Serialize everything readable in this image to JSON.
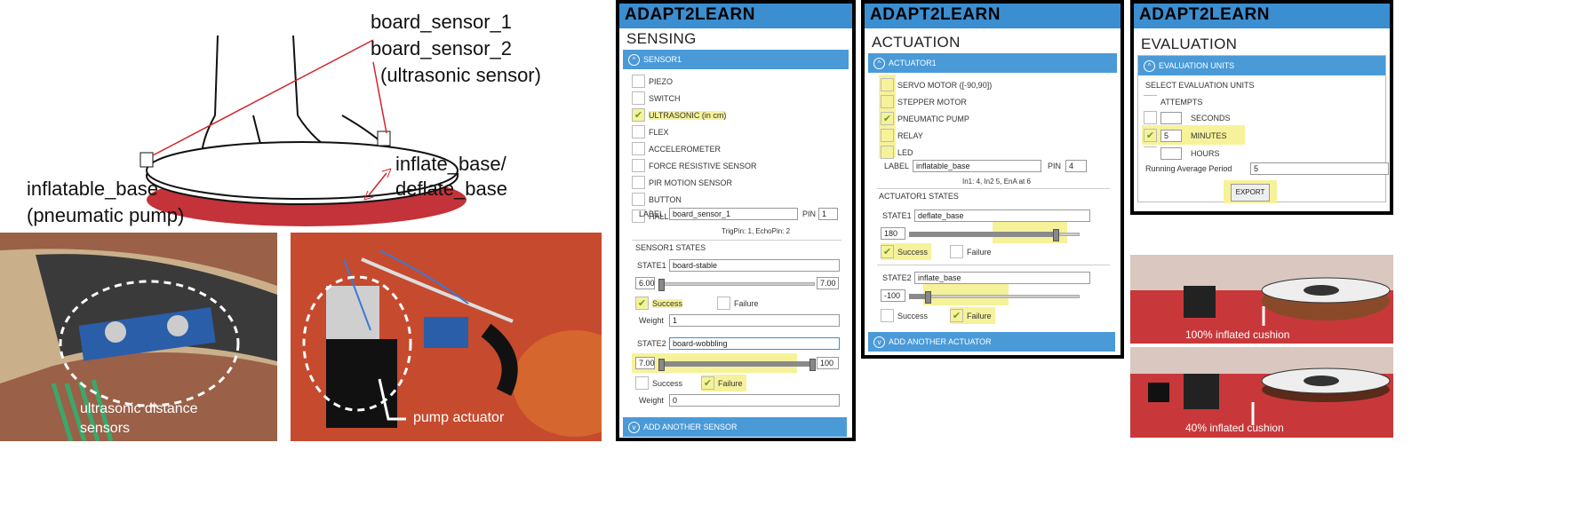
{
  "diagram": {
    "labels": {
      "board_sensor_1": "board_sensor_1",
      "board_sensor_2": "board_sensor_2",
      "ultrasonic": "(ultrasonic sensor)",
      "inflatable_base": "inflatable_base",
      "pneumatic_pump": "(pneumatic pump)",
      "inflate": "inflate_base/",
      "deflate": "deflate_base"
    }
  },
  "photos": {
    "sensors_caption_1": "ultrasonic distance",
    "sensors_caption_2": "sensors",
    "pump_caption": "pump actuator",
    "cushion_100": "100% inflated cushion",
    "cushion_40": "40% inflated cushion"
  },
  "colors": {
    "accent": "#3b8ed0",
    "highlight": "#f6f29a",
    "check": "#6a9a2a"
  },
  "sensing": {
    "app_title": "ADAPT2LEARN",
    "section": "SENSING",
    "group": "SENSOR1",
    "options": [
      {
        "label": "PIEZO",
        "checked": false
      },
      {
        "label": "SWITCH",
        "checked": false
      },
      {
        "label": "ULTRASONIC (in cm)",
        "checked": true
      },
      {
        "label": "FLEX",
        "checked": false
      },
      {
        "label": "ACCELEROMETER",
        "checked": false
      },
      {
        "label": "FORCE RESISTIVE SENSOR",
        "checked": false
      },
      {
        "label": "PIR MOTION SENSOR",
        "checked": false
      },
      {
        "label": "BUTTON",
        "checked": false
      },
      {
        "label": "HALL SENSOR",
        "checked": false
      }
    ],
    "label_caption": "LABEL",
    "label_value": "board_sensor_1",
    "pin_caption": "PIN",
    "pin_value": "1",
    "pin_hint": "TrigPin: 1, EchoPin: 2",
    "states_title": "SENSOR1 STATES",
    "state1": {
      "caption": "STATE1",
      "value": "board-stable",
      "min": "6.00",
      "max": "7.00",
      "level": 0.0,
      "success": "Success",
      "failure": "Failure",
      "success_checked": true,
      "failure_checked": false,
      "weight_caption": "Weight",
      "weight": "1"
    },
    "state2": {
      "caption": "STATE2",
      "value": "board-wobbling",
      "min": "7.00",
      "max": "100",
      "level": 1.0,
      "success": "Success",
      "failure": "Failure",
      "success_checked": false,
      "failure_checked": true,
      "weight_caption": "Weight",
      "weight": "0"
    },
    "add_more": "ADD ANOTHER SENSOR"
  },
  "actuation": {
    "app_title": "ADAPT2LEARN",
    "section": "ACTUATION",
    "group": "ACTUATOR1",
    "options": [
      {
        "label": "SERVO MOTOR ([-90,90])",
        "checked": false
      },
      {
        "label": "STEPPER MOTOR",
        "checked": false
      },
      {
        "label": "PNEUMATIC PUMP",
        "checked": true
      },
      {
        "label": "RELAY",
        "checked": false
      },
      {
        "label": "LED",
        "checked": false
      }
    ],
    "label_caption": "LABEL",
    "label_value": "inflatable_base",
    "pin_caption": "PIN",
    "pin_value": "4",
    "pin_hint": "In1: 4, In2 5, EnA at 6",
    "states_title": "ACTUATOR1 STATES",
    "state1": {
      "caption": "STATE1",
      "value": "deflate_base",
      "num": "180",
      "level": 0.88,
      "success": "Success",
      "failure": "Failure",
      "success_checked": true,
      "failure_checked": false
    },
    "state2": {
      "caption": "STATE2",
      "value": "inflate_base",
      "num": "-100",
      "level": 0.1,
      "success": "Success",
      "failure": "Failure",
      "success_checked": false,
      "failure_checked": true
    },
    "add_more": "ADD ANOTHER ACTUATOR"
  },
  "evaluation": {
    "app_title": "ADAPT2LEARN",
    "section": "EVALUATION",
    "group": "EVALUATION UNITS",
    "prompt": "SELECT EVALUATION UNITS",
    "units": [
      {
        "label": "ATTEMPTS",
        "value": "",
        "checked": false
      },
      {
        "label": "SECONDS",
        "value": "",
        "checked": false
      },
      {
        "label": "MINUTES",
        "value": "5",
        "checked": true
      },
      {
        "label": "HOURS",
        "value": "",
        "checked": false
      }
    ],
    "running_caption": "Running Average Period",
    "running_value": "5",
    "export": "EXPORT"
  }
}
